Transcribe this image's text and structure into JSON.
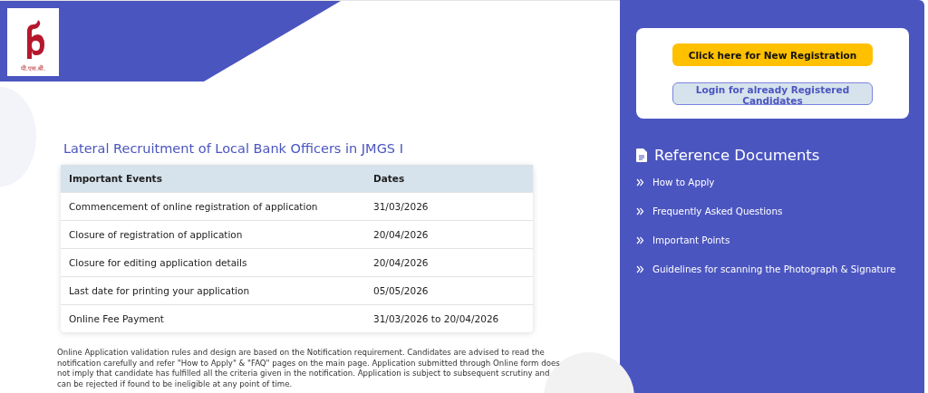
{
  "logo": {
    "caption": "पी.एस.बी."
  },
  "title": "Lateral Recruitment of Local Bank Officers in JMGS I",
  "table": {
    "columns": [
      "Important Events",
      "Dates"
    ],
    "rows": [
      [
        "Commencement of online registration of application",
        "31/03/2026"
      ],
      [
        "Closure of registration of application",
        "20/04/2026"
      ],
      [
        "Closure for editing application details",
        "20/04/2026"
      ],
      [
        "Last date for printing your application",
        "05/05/2026"
      ],
      [
        "Online Fee Payment",
        "31/03/2026 to 20/04/2026"
      ]
    ]
  },
  "note": "Online Application validation rules and design are based on the Notification requirement. Candidates are advised to read the notification carefully and refer \"How to Apply\" & \"FAQ\" pages on the main page. Application submitted through Online form does not imply that candidate has fulfilled all the criteria given in the notification. Application is subject to subsequent scrutiny and can be rejected if found to be ineligible at any point of time.",
  "sidebar": {
    "buttons": [
      {
        "label": "Click here for New Registration",
        "kind": "primary"
      },
      {
        "label": "Login for already Registered Candidates",
        "kind": "secondary"
      }
    ],
    "heading": "Reference Documents",
    "links": [
      "How to Apply",
      "Frequently Asked Questions",
      "Important Points",
      "Guidelines for scanning the Photograph & Signature"
    ]
  }
}
